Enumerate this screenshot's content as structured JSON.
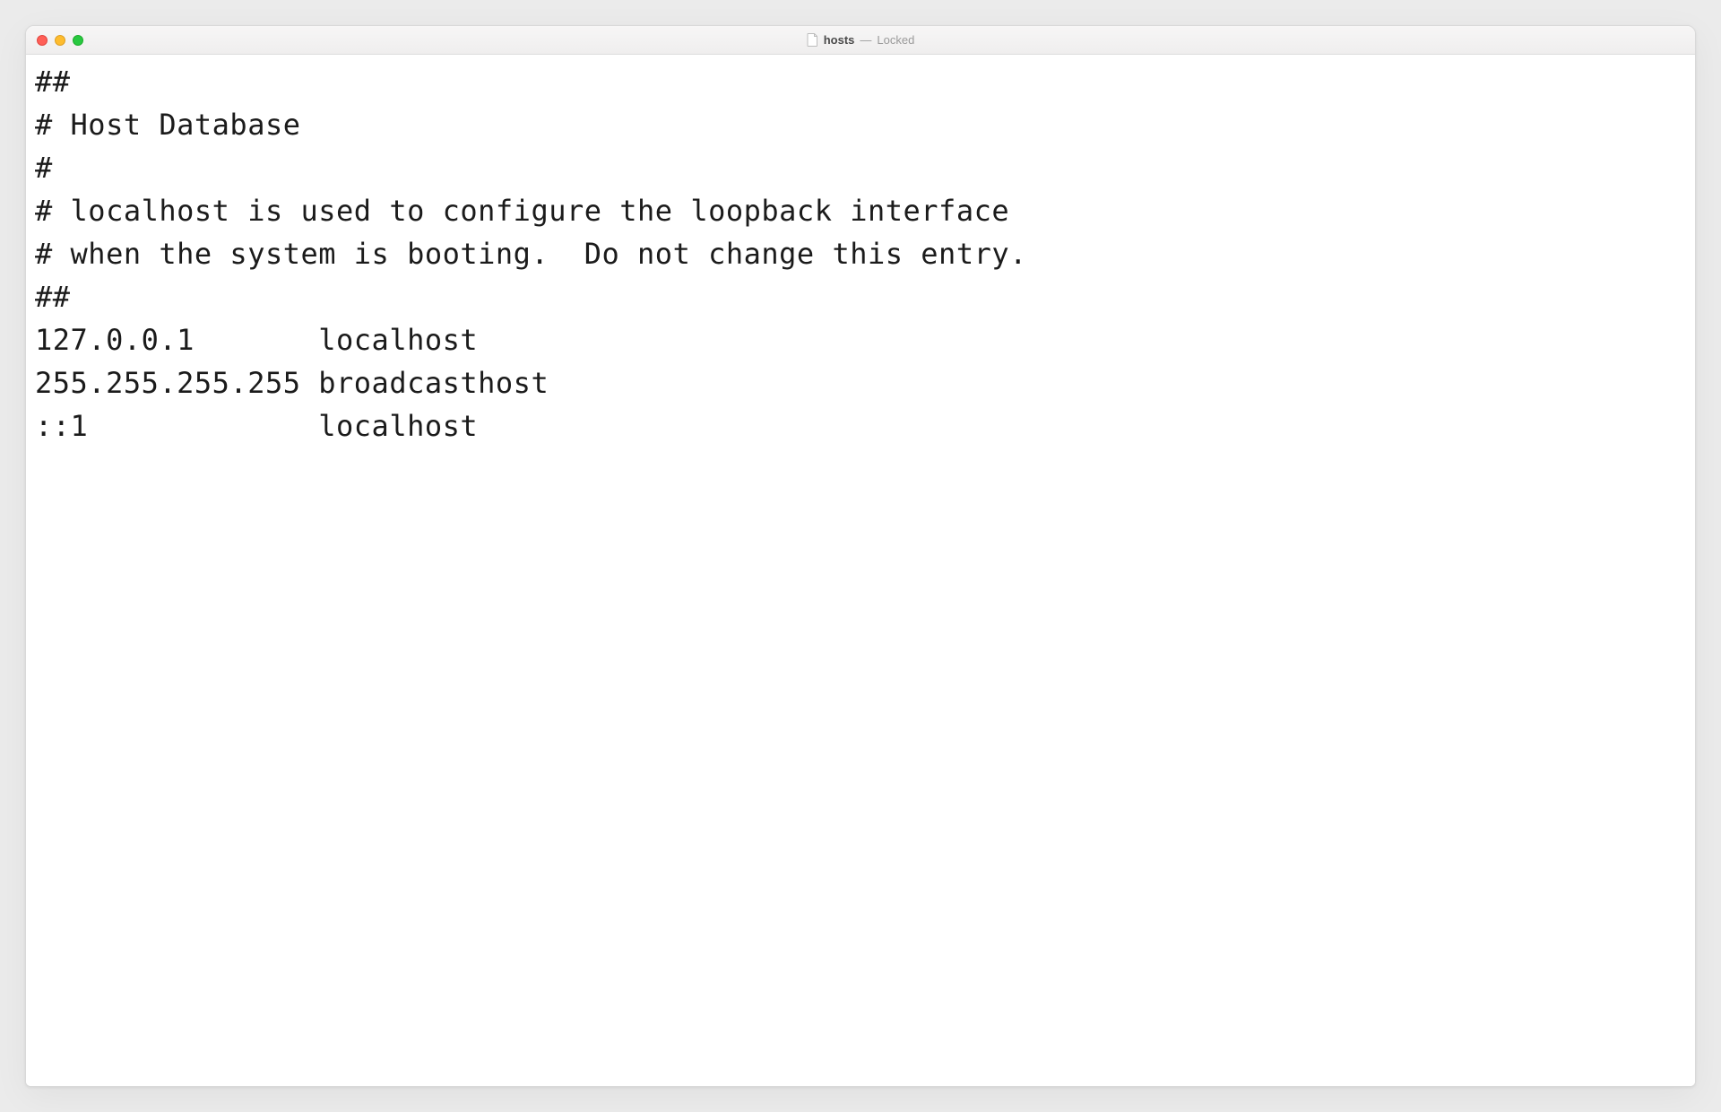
{
  "window": {
    "filename": "hosts",
    "separator": "—",
    "status": "Locked"
  },
  "file": {
    "lines": [
      "##",
      "# Host Database",
      "#",
      "# localhost is used to configure the loopback interface",
      "# when the system is booting.  Do not change this entry.",
      "##",
      "127.0.0.1       localhost",
      "255.255.255.255 broadcasthost",
      "::1             localhost"
    ]
  }
}
